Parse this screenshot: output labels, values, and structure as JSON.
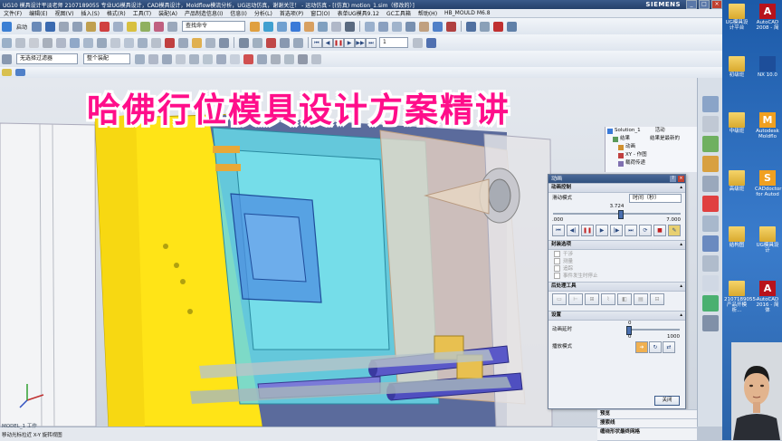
{
  "window": {
    "title": "UG10 模具设计平淡老师 2107189055 专业UG模具设计，CAD模具设计，Moldflow模流分析，UG运动仿真，谢谢关注！ - 运动仿真 - [(仿真) motion_1.sim（修改的）]",
    "brand": "SIEMENS"
  },
  "menubar": {
    "items": [
      "文件(F)",
      "编辑(E)",
      "视图(V)",
      "插入(S)",
      "格式(R)",
      "工具(T)",
      "装配(A)",
      "产品制造信息(I)",
      "信息(I)",
      "分析(L)",
      "首选项(P)",
      "窗口(O)",
      "表单UG模具9.12",
      "GC工具箱",
      "帮助(H)",
      "HB_MOULD M6.8"
    ]
  },
  "toolbar": {
    "start_label": "启动",
    "search_placeholder": "查找命令",
    "filter_label": "无选择过滤器",
    "assembly_label": "整个装配",
    "frame_value": "1"
  },
  "overlay": {
    "headline": "哈佛行位模具设计方案精讲"
  },
  "navtree": {
    "items": [
      {
        "label": "Solution_1",
        "value": "活动"
      },
      {
        "label": "结果",
        "value": "结果是最新的"
      },
      {
        "label": "动画",
        "value": ""
      },
      {
        "label": "XY - 作图",
        "value": ""
      },
      {
        "label": "载荷传递",
        "value": ""
      }
    ]
  },
  "dialog": {
    "title": "动画",
    "sections": {
      "control": "动画控制",
      "package": "封装选项",
      "tracking": "后处理工具",
      "settings": "设置"
    },
    "slide_mode_label": "滑动模式",
    "slide_mode_value": "时间（秒）",
    "time_current": "3.724",
    "time_min": ".000",
    "time_max": "7.000",
    "time_fraction": 0.532,
    "package_options": [
      "干涉",
      "测量",
      "追踪",
      "事件发生时停止"
    ],
    "delay_label": "动画延时",
    "delay_value": "0",
    "delay_min": "0",
    "delay_max": "1000",
    "playback_label": "播放模式",
    "ok_label": "关闭"
  },
  "bottom_panels": [
    "预览",
    "搜索线",
    "缠绕形状最终网格"
  ],
  "statusbar": {
    "view_name": "MODEL_1 工作",
    "hint": "移动光标拉近 X-Y 旋转视图"
  },
  "desktop": {
    "icons": [
      {
        "label": "UG模具设计平台",
        "kind": "folder"
      },
      {
        "label": "AutoCAD 2008 - 简",
        "kind": "acad"
      },
      {
        "label": "初级班",
        "kind": "folder"
      },
      {
        "label": "NX 10.0",
        "kind": "nx"
      },
      {
        "label": "中级班",
        "kind": "folder"
      },
      {
        "label": "Autodesk Moldflo",
        "kind": "autosd"
      },
      {
        "label": "高级班",
        "kind": "folder"
      },
      {
        "label": "CADdoctor for Autod",
        "kind": "autosd"
      },
      {
        "label": "结构图",
        "kind": "folder"
      },
      {
        "label": "UG模具设计",
        "kind": "folder"
      },
      {
        "label": "2107189055-产品开模析...",
        "kind": "folder"
      },
      {
        "label": "AutoCAD 2016 - 简体",
        "kind": "acad"
      }
    ]
  }
}
